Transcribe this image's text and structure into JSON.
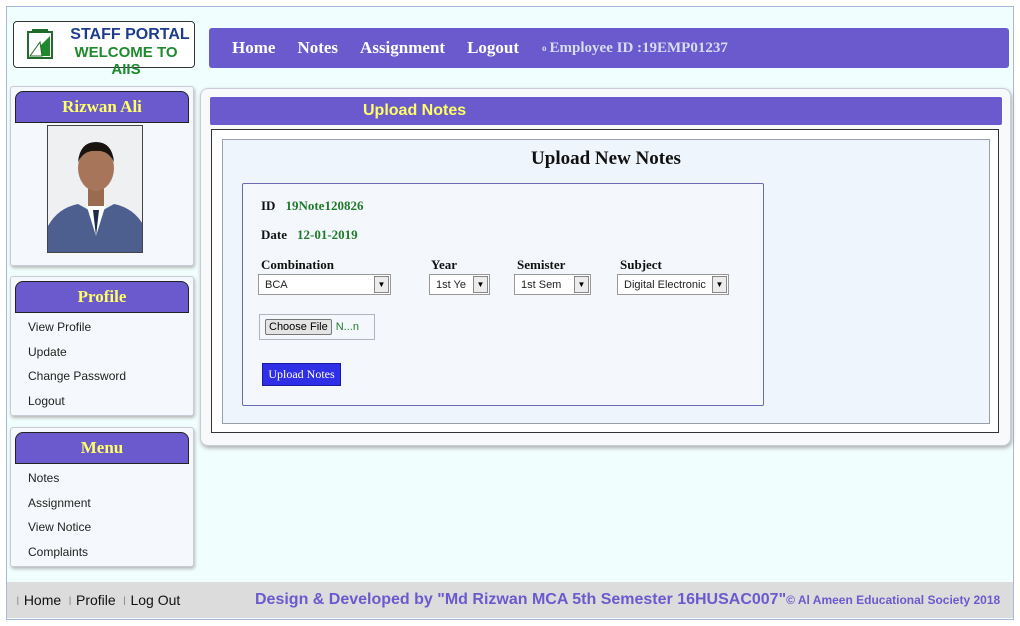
{
  "header": {
    "logo_line1": "STAFF PORTAL",
    "logo_line2": "WELCOME TO AIIS"
  },
  "nav": {
    "items": [
      "Home",
      "Notes",
      "Assignment",
      "Logout"
    ],
    "employee_id": "Employee ID :19EMP01237"
  },
  "profile_card": {
    "name": "Rizwan Ali"
  },
  "profile_menu": {
    "title": "Profile",
    "items": [
      "View Profile",
      "Update",
      "Change Password",
      "Logout"
    ]
  },
  "main_menu": {
    "title": "Menu",
    "items": [
      "Notes",
      "Assignment",
      "View Notice",
      "Complaints"
    ]
  },
  "page": {
    "title": "Upload Notes",
    "form_heading": "Upload New Notes",
    "id_label": "ID",
    "id_value": "19Note120826",
    "date_label": "Date",
    "date_value": "12-01-2019",
    "combination_label": "Combination",
    "combination_value": "BCA",
    "year_label": "Year",
    "year_value": "1st Ye",
    "semester_label": "Semister",
    "semester_value": "1st Sem",
    "subject_label": "Subject",
    "subject_value": "Digital Electronic",
    "file_button": "Choose File",
    "file_name": "N...n",
    "upload_button": "Upload Notes"
  },
  "footer": {
    "links": [
      "Home",
      "Profile",
      "Log Out"
    ],
    "credit": "Design & Developed by \"Md Rizwan MCA 5th Semester 16HUSAC007\"",
    "copyright": "© Al Ameen Educational Society 2018"
  },
  "colors": {
    "accent": "#6a5acd",
    "heading_yellow": "#ffff66",
    "value_green": "#1f7a2a",
    "upload_blue": "#2f2fe8"
  }
}
